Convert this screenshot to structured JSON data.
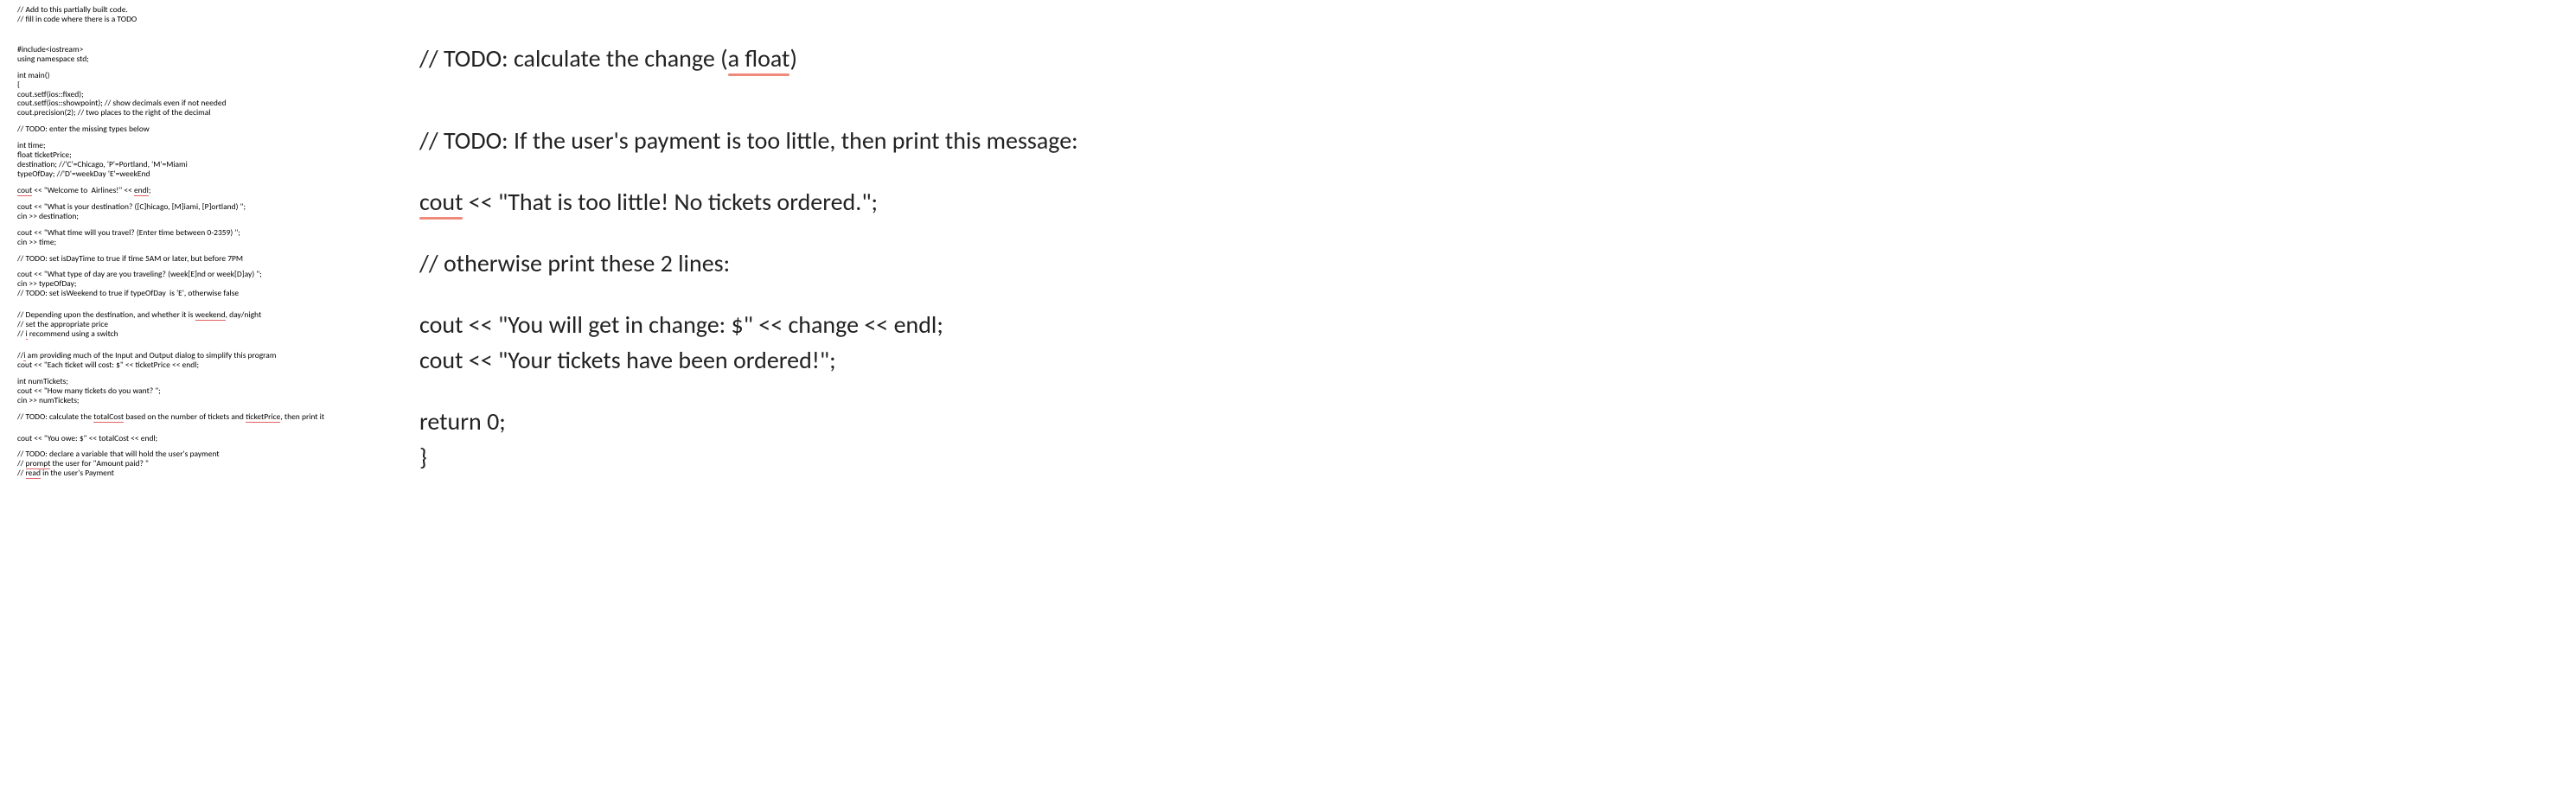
{
  "left": {
    "l1": "// Add to this partially built code.",
    "l2": "// fill in code where there is a TODO",
    "l3": "#include<iostream>",
    "l4": "using namespace std;",
    "l5": "int main()",
    "l6": "{",
    "l7": "cout.setf(ios::fixed);",
    "l8": "cout.setf(ios::showpoint); // show decimals even if not needed",
    "l9": "cout.precision(2); // two places to the right of the decimal",
    "l10": "// TODO: enter the missing types below",
    "l11": "int time;",
    "l12": "float ticketPrice;",
    "l13": "destination; //'C'=Chicago, 'P'=Portland, 'M'=Miami",
    "l14": "typeOfDay; //'D'=weekDay 'E'=weekEnd",
    "l15a": "cout",
    "l15b": " << \"Welcome to  Airlines!\" << ",
    "l15c": "endl",
    "l15d": ";",
    "l16": "cout << \"What is your destination? ([C]hicago, [M]iami, [P]ortland) \";",
    "l17": "cin >> destination;",
    "l18": "cout << \"What time will you travel? (Enter time between 0-2359) \";",
    "l19": "cin >> time;",
    "l20": "// TODO: set isDayTime to true if time 5AM or later, but before 7PM",
    "l21": "cout << \"What type of day are you traveling? (week[E]nd or week[D]ay) \";",
    "l22": "cin >> typeOfDay;",
    "l23": "// TODO: set isWeekend to true if typeOfDay  is 'E', otherwise false",
    "l24a": "// Depending upon the destination, and whether it is ",
    "l24b": "weekend",
    "l24c": ", day/night",
    "l25": "// set the appropriate price",
    "l26a": "// ",
    "l26b": "i",
    "l26c": " recommend using a switch",
    "l27a": "//",
    "l27b": "i",
    "l27c": " am providing much of the Input and Output dialog to simplify this program",
    "l28": "cout << \"Each ticket will cost: $\" << ticketPrice << endl;",
    "l29": "int numTickets;",
    "l30": "cout << \"How many tickets do you want? \";",
    "l31": "cin >> numTickets;",
    "l32a": "// TODO: calculate the ",
    "l32b": "totalCost",
    "l32c": " based on the number of tickets and ",
    "l32d": "ticketPrice",
    "l32e": ", then print it",
    "l33": "cout << \"You owe: $\" << totalCost << endl;",
    "l34": "// TODO: declare a variable that will hold the user's payment",
    "l35a": "// ",
    "l35b": "prompt",
    "l35c": " the user for \"Amount paid? \"",
    "l36a": "// ",
    "l36b": "read",
    "l36c": " in the user's Payment"
  },
  "right": {
    "r1a": "// TODO: calculate the change (",
    "r1b": "a float",
    "r1c": ")",
    "r2": "// TODO: If the user's payment is too little, then print this message:",
    "r3a": "cout",
    "r3b": " << \"That is too little! No tickets ordered.\";",
    "r4": "// otherwise print these 2 lines:",
    "r5": "cout << \"You will get in change: $\" << change << endl;",
    "r6": "cout << \"Your tickets have been ordered!\";",
    "r7": "return 0;",
    "r8": "}"
  }
}
